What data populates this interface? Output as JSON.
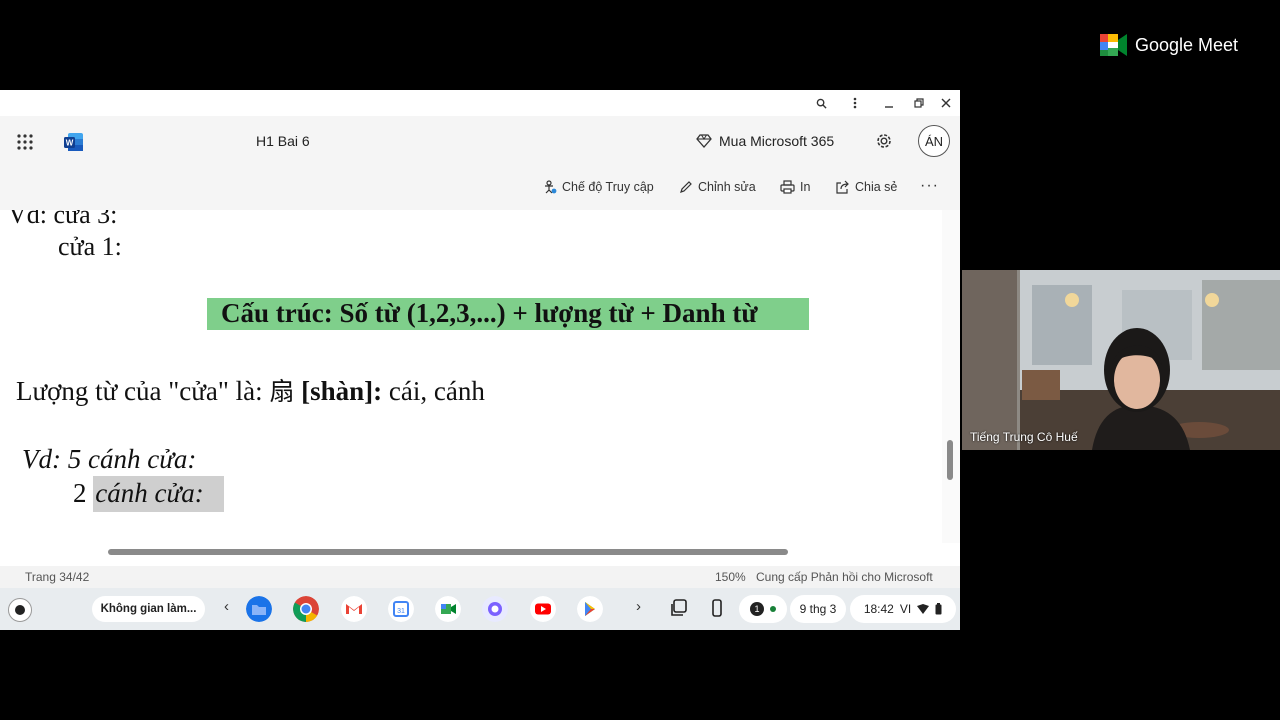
{
  "meet": {
    "brand": "Google Meet",
    "participant_name": "Tiếng Trung Cô Huế"
  },
  "word": {
    "doc_title": "H1 Bai 6",
    "buy_label": "Mua Microsoft 365",
    "avatar_initials": "ÁN",
    "toolbar": {
      "access_mode": "Chế độ Truy cập",
      "edit": "Chỉnh sửa",
      "print": "In",
      "share": "Chia sẻ",
      "more": "···"
    },
    "status": {
      "page": "Trang 34/42",
      "zoom": "150%",
      "feedback": "Cung cấp Phản hồi cho Microsoft"
    }
  },
  "document": {
    "line1": "Vd: cửa 3:",
    "line2": "cửa 1:",
    "structure_heading": "Cấu trúc: Số từ (1,2,3,...) + lượng từ + Danh từ",
    "classifier_prefix": "Lượng từ của \"cửa\"  là: ",
    "classifier_hanzi": "扇",
    "classifier_pinyin": " [shàn]:",
    "classifier_meaning": " cái, cánh",
    "example1": "Vd:  5 cánh cửa:",
    "example2_num": "2 ",
    "example2_text": "cánh cửa:"
  },
  "taskbar": {
    "desk_label": "Không gian làm...",
    "date": "9 thg 3",
    "time": "18:42",
    "lang": "VI",
    "notification_count": "1"
  },
  "colors": {
    "highlight": "#7fcf8b",
    "selection": "#cfcfcf",
    "word_blue": "#185abd"
  }
}
